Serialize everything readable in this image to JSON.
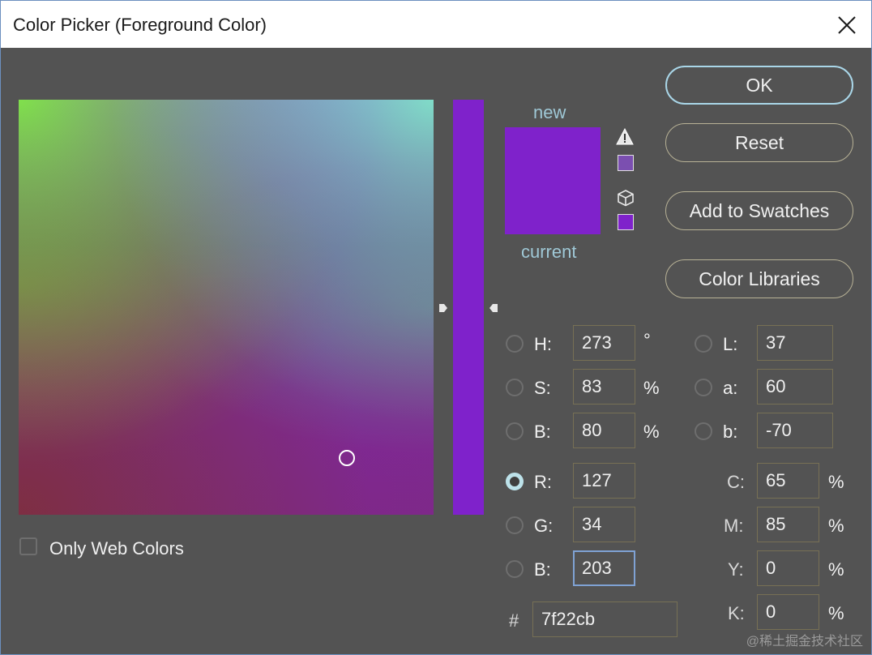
{
  "window": {
    "title": "Color Picker (Foreground Color)"
  },
  "colors": {
    "selected": "#7f22cb",
    "accent": "#a9d6e8",
    "background": "#535353"
  },
  "swatches": {
    "new_label": "new",
    "current_label": "current",
    "gamut_warning_icon": "warning-triangle-icon",
    "web_safe_icon": "cube-icon"
  },
  "buttons": {
    "ok": "OK",
    "reset": "Reset",
    "add_to_swatches": "Add to Swatches",
    "color_libraries": "Color Libraries"
  },
  "hsb": {
    "h_label": "H:",
    "h_value": "273",
    "h_unit": "°",
    "s_label": "S:",
    "s_value": "83",
    "s_unit": "%",
    "b_label": "B:",
    "b_value": "80",
    "b_unit": "%"
  },
  "rgb": {
    "r_label": "R:",
    "r_value": "127",
    "g_label": "G:",
    "g_value": "34",
    "b_label": "B:",
    "b_value": "203",
    "selected_channel": "R"
  },
  "lab": {
    "l_label": "L:",
    "l_value": "37",
    "a_label": "a:",
    "a_value": "60",
    "b_label": "b:",
    "b_value": "-70"
  },
  "cmyk": {
    "c_label": "C:",
    "c_value": "65",
    "c_unit": "%",
    "m_label": "M:",
    "m_value": "85",
    "m_unit": "%",
    "y_label": "Y:",
    "y_value": "0",
    "y_unit": "%",
    "k_label": "K:",
    "k_value": "0",
    "k_unit": "%"
  },
  "hex": {
    "label": "#",
    "value": "7f22cb"
  },
  "options": {
    "only_web_colors": "Only Web Colors",
    "only_web_colors_checked": false
  },
  "watermark": "@稀土掘金技术社区"
}
